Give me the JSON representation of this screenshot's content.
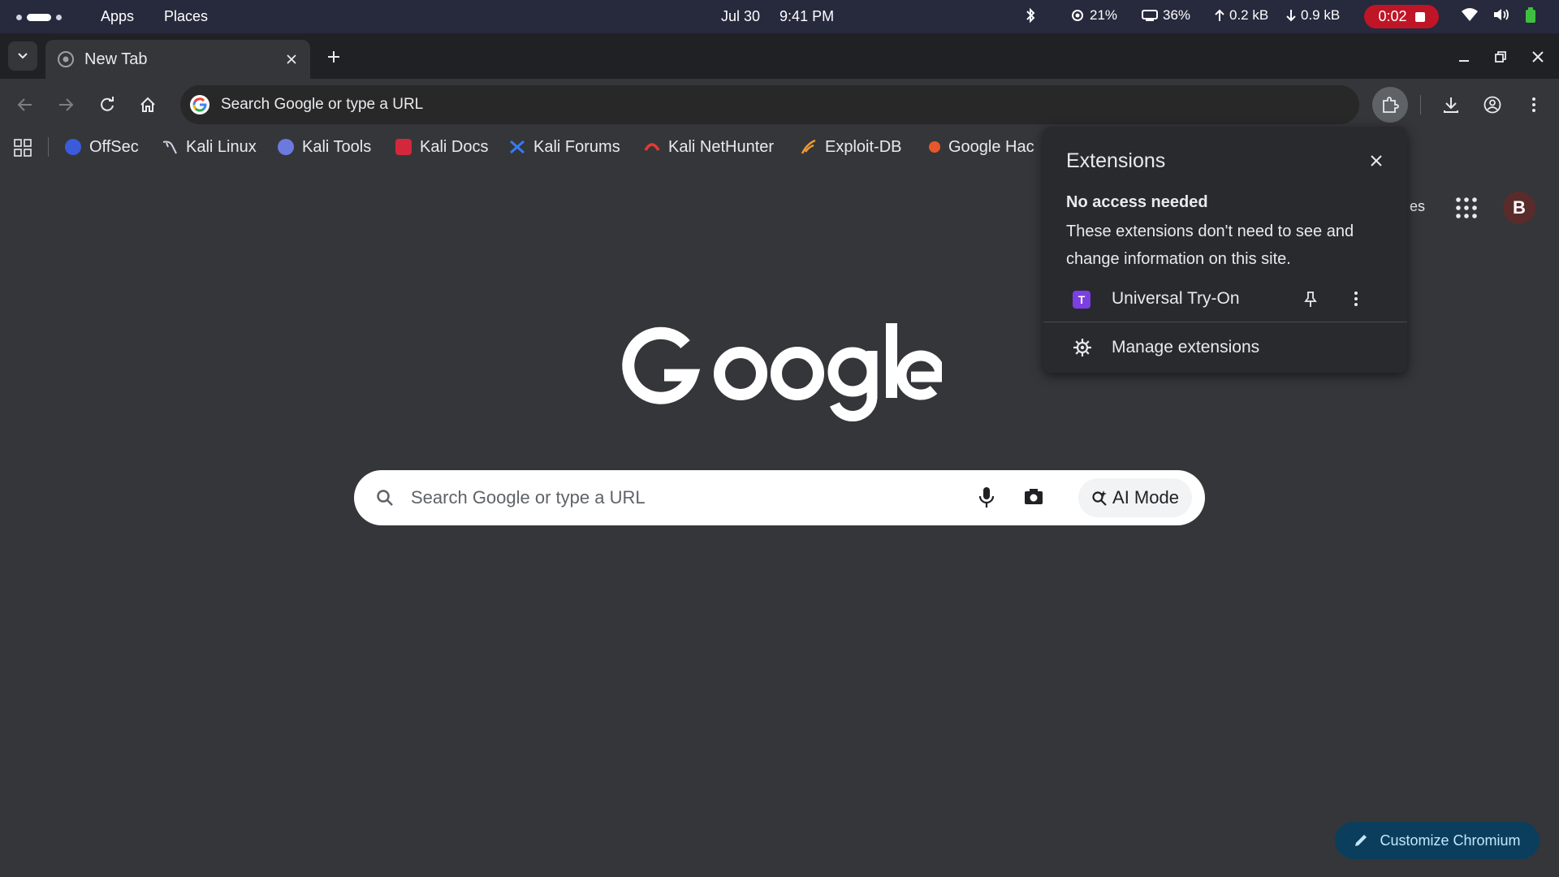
{
  "system_bar": {
    "apps_label": "Apps",
    "places_label": "Places",
    "date": "Jul 30",
    "time": "9:41 PM",
    "cpu": "21%",
    "memory": "36%",
    "upload": "0.2 kB",
    "download": "0.9 kB",
    "recording_time": "0:02"
  },
  "tabs": [
    {
      "title": "New Tab"
    }
  ],
  "omnibox": {
    "text": "Search Google or type a URL"
  },
  "bookmarks": [
    {
      "label": "OffSec",
      "icon": "offsec-icon",
      "color": "#3b5bdb"
    },
    {
      "label": "Kali Linux",
      "icon": "kali-dragon-icon",
      "color": "#cfd2e0"
    },
    {
      "label": "Kali Tools",
      "icon": "kali-tools-icon",
      "color": "#6c7ae0"
    },
    {
      "label": "Kali Docs",
      "icon": "kali-docs-icon",
      "color": "#d3283a"
    },
    {
      "label": "Kali Forums",
      "icon": "kali-forums-icon",
      "color": "#367bf0"
    },
    {
      "label": "Kali NetHunter",
      "icon": "nethunter-icon",
      "color": "#e53935"
    },
    {
      "label": "Exploit-DB",
      "icon": "exploit-db-icon",
      "color": "#f29b30"
    },
    {
      "label": "Google Hac",
      "icon": "ghdb-icon",
      "color": "#e8572a"
    }
  ],
  "ntp": {
    "header_link": "es",
    "avatar_letter": "B",
    "search_placeholder": "Search Google or type a URL",
    "ai_mode_label": "AI Mode",
    "customize_label": "Customize Chromium"
  },
  "extensions_popup": {
    "title": "Extensions",
    "section_heading": "No access needed",
    "section_description": "These extensions don't need to see and change information on this site.",
    "items": [
      {
        "name": "Universal Try-On",
        "icon_letter": "T"
      }
    ],
    "manage_label": "Manage extensions"
  },
  "colors": {
    "accent": "#7b3fe4",
    "record": "#c01526",
    "customize_bg": "#0b3e5c"
  }
}
